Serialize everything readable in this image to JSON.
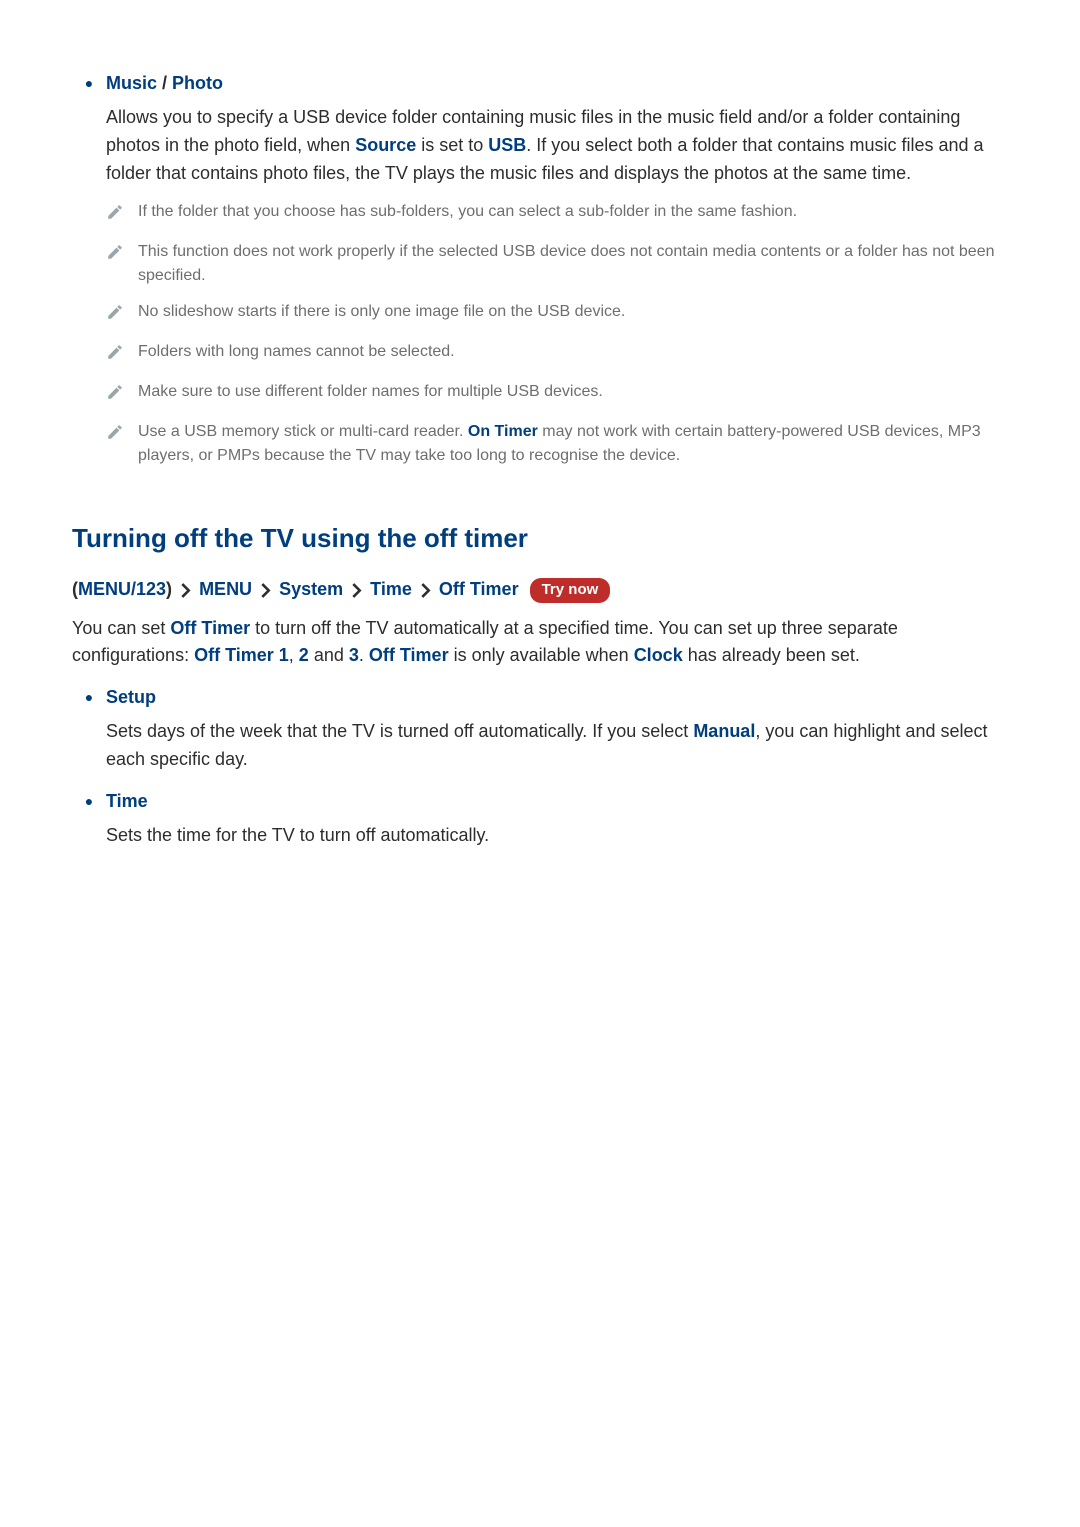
{
  "mp": {
    "music_label": "Music",
    "photo_label": "Photo",
    "slash": " / ",
    "body_pre": "Allows you to specify a USB device folder containing music files in the music field and/or a folder containing photos in the photo field, when ",
    "source": "Source",
    "body_mid1": " is set to ",
    "usb": "USB",
    "body_post": ". If you select both a folder that contains music files and a folder that contains photo files, the TV plays the music files and displays the photos at the same time.",
    "notes": {
      "n1": "If the folder that you choose has sub-folders, you can select a sub-folder in the same fashion.",
      "n2": "This function does not work properly if the selected USB device does not contain media contents or a folder has not been specified.",
      "n3": "No slideshow starts if there is only one image file on the USB device.",
      "n4": "Folders with long names cannot be selected.",
      "n5": "Make sure to use different folder names for multiple USB devices.",
      "n6_pre": "Use a USB memory stick or multi-card reader. ",
      "n6_on_timer": "On Timer",
      "n6_post": " may not work with certain battery-powered USB devices, MP3 players, or PMPs because the TV may take too long to recognise the device."
    }
  },
  "off_timer": {
    "heading": "Turning off the TV using the off timer",
    "crumbs": {
      "menu123": "MENU/123",
      "menu": "MENU",
      "system": "System",
      "time": "Time",
      "off_timer": "Off Timer"
    },
    "try_now": "Try now",
    "p_pre": "You can set ",
    "p_off_timer": "Off Timer",
    "p_mid1": " to turn off the TV automatically at a specified time. You can set up three separate configurations: ",
    "p_ot1": "Off Timer 1",
    "p_comma": ", ",
    "p_ot2": "2",
    "p_and": " and ",
    "p_ot3": "3",
    "p_dot": ". ",
    "p_off_timer2": "Off Timer",
    "p_mid2": " is only available when ",
    "p_clock": "Clock",
    "p_post": " has already been set.",
    "setup": {
      "label": "Setup",
      "body_pre": "Sets days of the week that the TV is turned off automatically. If you select ",
      "manual": "Manual",
      "body_post": ", you can highlight and select each specific day."
    },
    "time": {
      "label": "Time",
      "body": "Sets the time for the TV to turn off automatically."
    }
  }
}
